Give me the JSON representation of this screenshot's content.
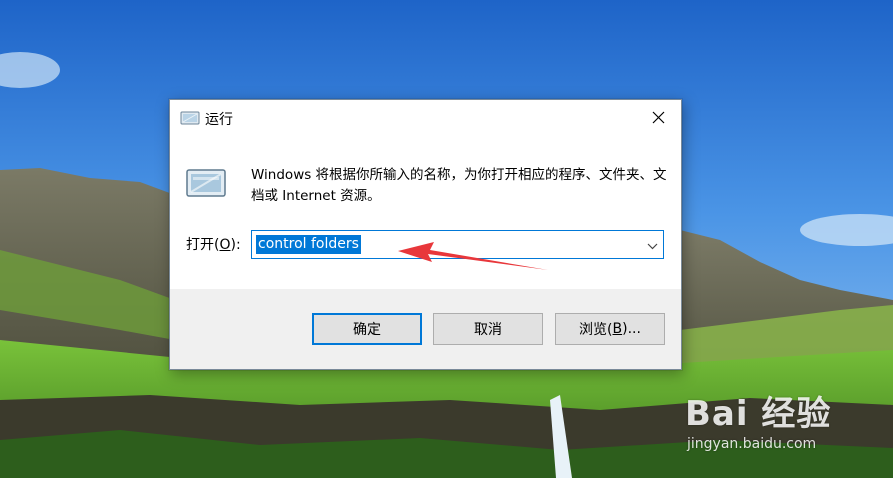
{
  "dialog": {
    "title": "运行",
    "description": "Windows 将根据你所输入的名称，为你打开相应的程序、文件夹、文档或 Internet 资源。",
    "open_label_prefix": "打开(",
    "open_label_key": "O",
    "open_label_suffix": "):",
    "command_value": "control folders",
    "ok_label": "确定",
    "cancel_label": "取消",
    "browse_label_prefix": "浏览(",
    "browse_label_key": "B",
    "browse_label_suffix": ")..."
  },
  "watermark": {
    "brand": "Bai 经验",
    "url": "jingyan.baidu.com"
  },
  "colors": {
    "accent": "#0078d7",
    "annotation_arrow": "#e8373b"
  },
  "icons": [
    "run-icon",
    "close-icon",
    "chevron-down-icon",
    "baidu-paw-logo"
  ]
}
